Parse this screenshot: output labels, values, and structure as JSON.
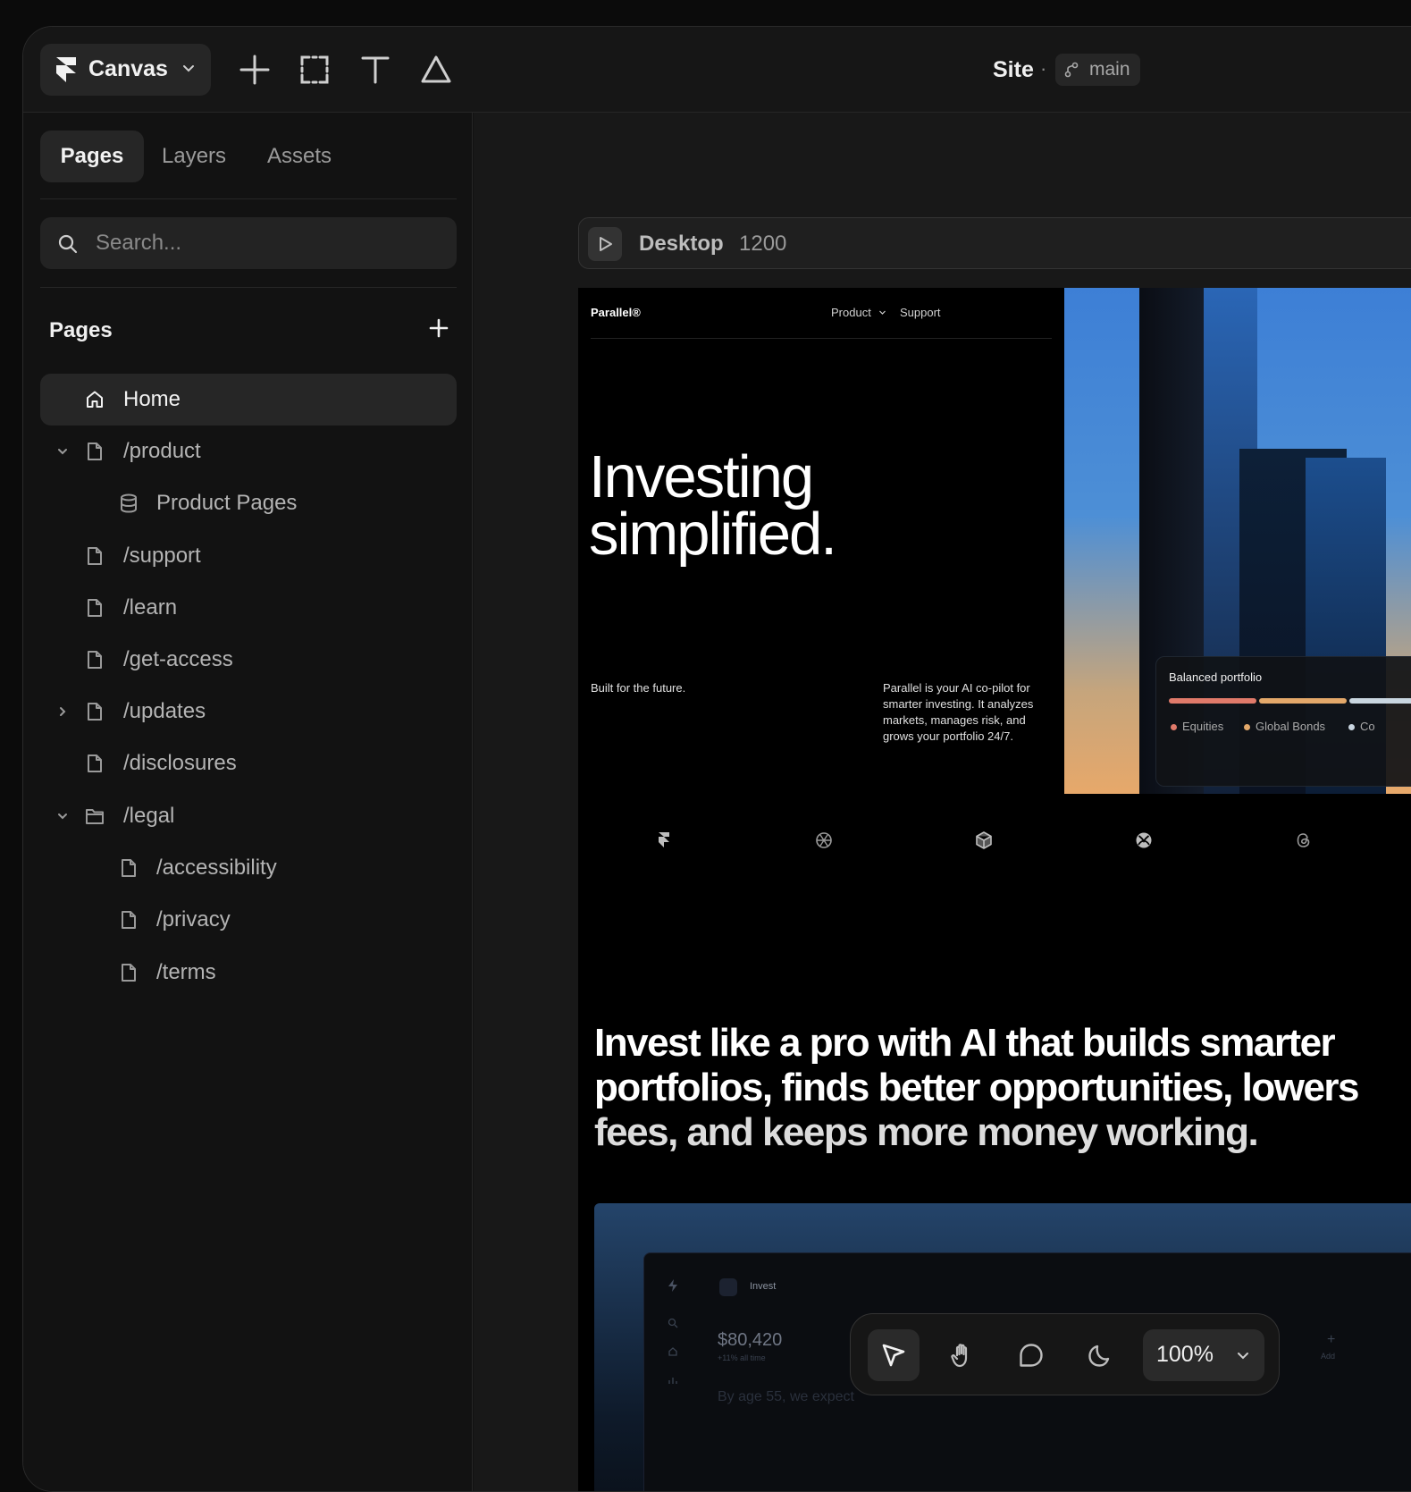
{
  "topbar": {
    "canvas_label": "Canvas",
    "site_title": "Site",
    "separator": "·",
    "branch": "main",
    "tools": [
      "plus-icon",
      "frame-icon",
      "text-icon",
      "shape-icon"
    ]
  },
  "sidebar": {
    "tabs": [
      {
        "label": "Pages",
        "active": true
      },
      {
        "label": "Layers",
        "active": false
      },
      {
        "label": "Assets",
        "active": false
      }
    ],
    "search_placeholder": "Search...",
    "section_title": "Pages",
    "pages": [
      {
        "label": "Home",
        "icon": "home-icon",
        "selected": true
      },
      {
        "label": "/product",
        "icon": "page-icon",
        "caret": "down"
      },
      {
        "label": "Product Pages",
        "icon": "database-icon"
      },
      {
        "label": "/support",
        "icon": "page-icon"
      },
      {
        "label": "/learn",
        "icon": "page-icon"
      },
      {
        "label": "/get-access",
        "icon": "page-icon"
      },
      {
        "label": "/updates",
        "icon": "page-icon",
        "caret": "right"
      },
      {
        "label": "/disclosures",
        "icon": "page-icon"
      },
      {
        "label": "/legal",
        "icon": "folder-icon",
        "caret": "down"
      },
      {
        "label": "/accessibility",
        "icon": "page-icon"
      },
      {
        "label": "/privacy",
        "icon": "page-icon"
      },
      {
        "label": "/terms",
        "icon": "page-icon"
      }
    ]
  },
  "canvas": {
    "frame_name": "Desktop",
    "frame_width": "1200",
    "site": {
      "brand": "Parallel®",
      "nav_product": "Product",
      "nav_support": "Support",
      "hero_line1": "Investing",
      "hero_line2": "simplified.",
      "hero_sub": "Built for the future.",
      "hero_desc": "Parallel is your AI co-pilot for smarter investing. It analyzes markets, manages risk, and grows your portfolio 24/7.",
      "portfolio_title": "Balanced portfolio",
      "legend": [
        "Equities",
        "Global Bonds",
        "Co"
      ],
      "legend_colors": [
        "#e07a6a",
        "#e3a86a",
        "#c9d6e0"
      ],
      "mid_line1": "Invest like a pro with AI that builds smarter",
      "mid_line2": "portfolios, finds better opportunities, lowers",
      "mid_line3": "fees, and keeps more money working.",
      "dash_invest": "Invest",
      "dash_amount": "$80,420",
      "dash_change": "+11% all time",
      "dash_add": "Add",
      "dash_add_plus": "+",
      "dash_sub": "By age 55, we expect"
    }
  },
  "bottom_toolbar": {
    "tools": [
      "pointer-icon",
      "hand-icon",
      "comment-icon",
      "moon-icon"
    ],
    "zoom": "100%"
  }
}
